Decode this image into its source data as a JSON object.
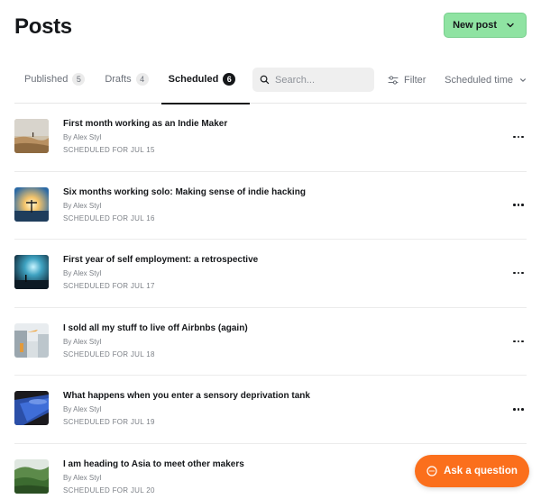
{
  "header": {
    "title": "Posts",
    "new_post_label": "New post"
  },
  "tabs": [
    {
      "label": "Published",
      "count": "5"
    },
    {
      "label": "Drafts",
      "count": "4"
    },
    {
      "label": "Scheduled",
      "count": "6",
      "active": true
    }
  ],
  "search": {
    "placeholder": "Search...",
    "value": ""
  },
  "filter": {
    "label": "Filter"
  },
  "sort": {
    "label": "Scheduled time"
  },
  "posts": [
    {
      "title": "First month working as an Indie Maker",
      "author": "By Alex Styl",
      "status": "SCHEDULED FOR JUL 15"
    },
    {
      "title": "Six months working solo: Making sense of indie hacking",
      "author": "By Alex Styl",
      "status": "SCHEDULED FOR JUL 16"
    },
    {
      "title": "First year of self employment: a retrospective",
      "author": "By Alex Styl",
      "status": "SCHEDULED FOR JUL 17"
    },
    {
      "title": "I sold all my stuff to live off Airbnbs (again)",
      "author": "By Alex Styl",
      "status": "SCHEDULED FOR JUL 18"
    },
    {
      "title": "What happens when you enter a sensory deprivation tank",
      "author": "By Alex Styl",
      "status": "SCHEDULED FOR JUL 19"
    },
    {
      "title": "I am heading to Asia to meet other makers",
      "author": "By Alex Styl",
      "status": "SCHEDULED FOR JUL 20"
    }
  ],
  "help": {
    "label": "Ask a question"
  },
  "colors": {
    "accent_green": "#8fe3a2",
    "accent_orange": "#fb6f1c",
    "text_primary": "#15171a",
    "text_muted": "#7c8087"
  }
}
